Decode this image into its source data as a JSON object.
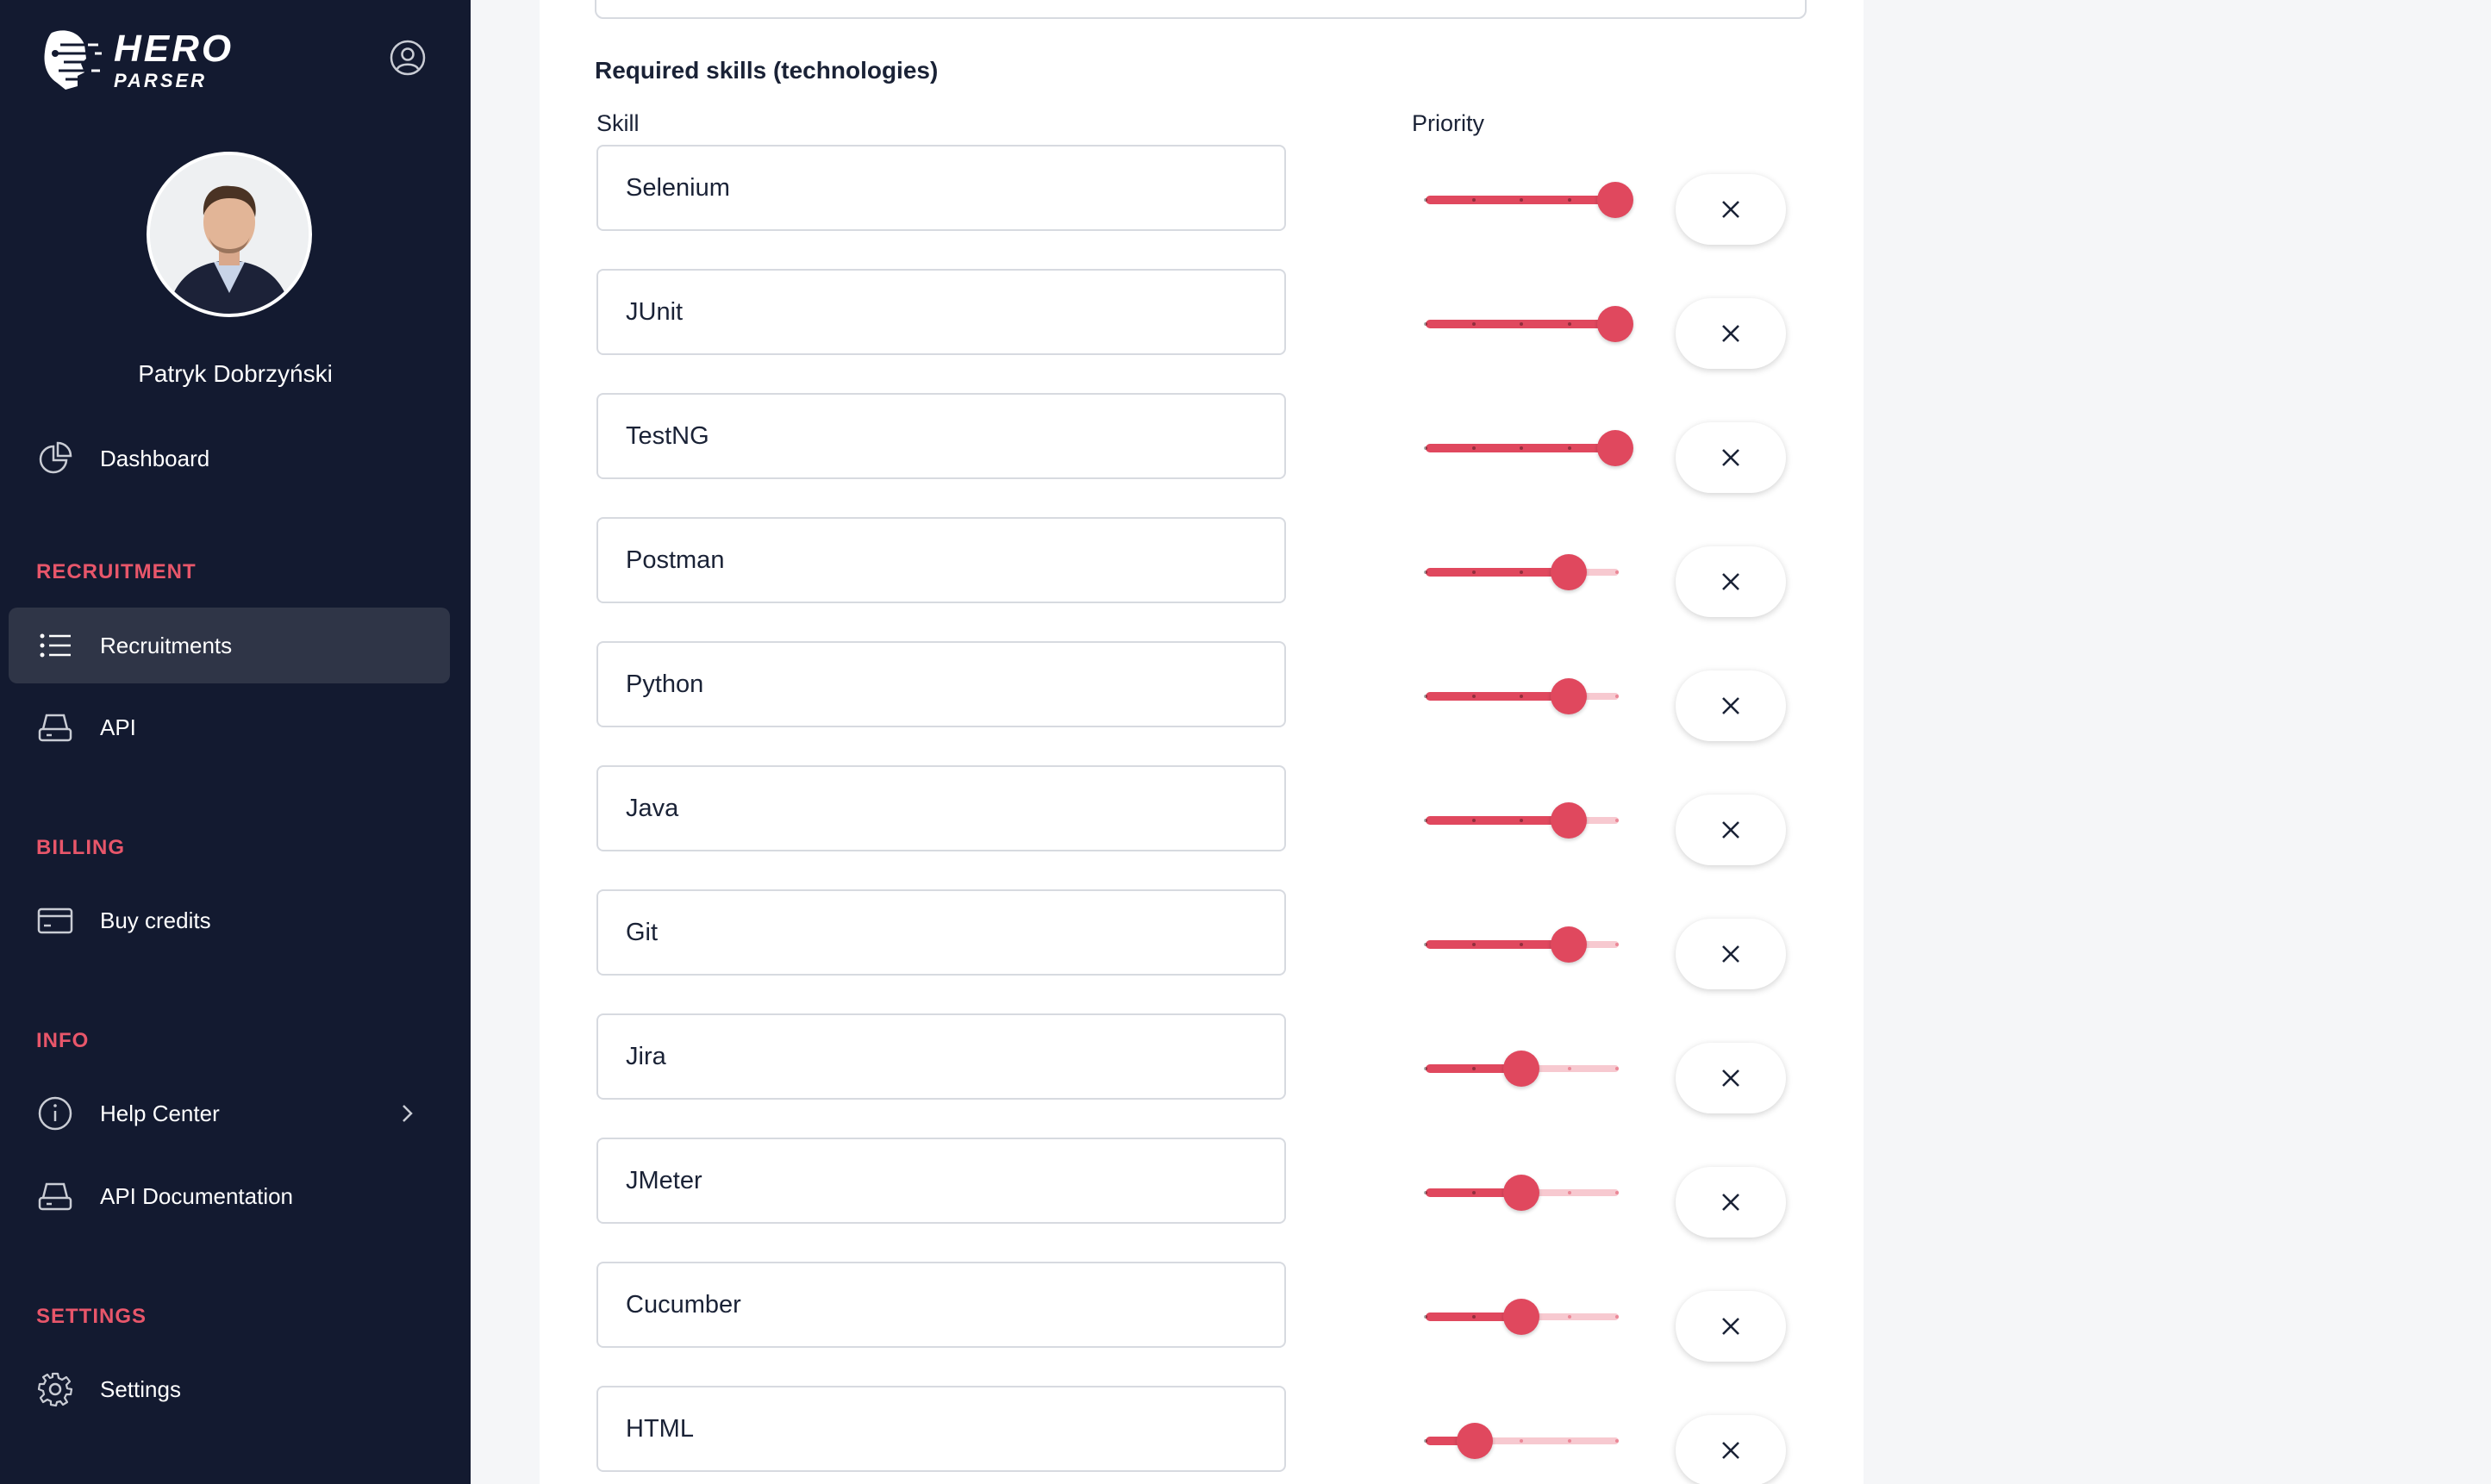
{
  "app": {
    "logo_line1": "HERO",
    "logo_line2": "PARSER"
  },
  "user": {
    "name": "Patryk Dobrzyński"
  },
  "sidebar": {
    "dashboard": "Dashboard",
    "sections": {
      "recruitment": "RECRUITMENT",
      "billing": "BILLING",
      "info": "INFO",
      "settings": "SETTINGS"
    },
    "items": {
      "recruitments": "Recruitments",
      "api": "API",
      "buy_credits": "Buy credits",
      "help_center": "Help Center",
      "api_documentation": "API Documentation",
      "settings": "Settings"
    }
  },
  "form": {
    "section_title": "Required skills (technologies)",
    "col_skill": "Skill",
    "col_priority": "Priority",
    "priority_max": 5,
    "skills": [
      {
        "name": "Selenium",
        "priority": 5
      },
      {
        "name": "JUnit",
        "priority": 5
      },
      {
        "name": "TestNG",
        "priority": 5
      },
      {
        "name": "Postman",
        "priority": 4
      },
      {
        "name": "Python",
        "priority": 4
      },
      {
        "name": "Java",
        "priority": 4
      },
      {
        "name": "Git",
        "priority": 4
      },
      {
        "name": "Jira",
        "priority": 3
      },
      {
        "name": "JMeter",
        "priority": 3
      },
      {
        "name": "Cucumber",
        "priority": 3
      },
      {
        "name": "HTML",
        "priority": 2
      }
    ]
  },
  "colors": {
    "sidebar_bg": "#131a30",
    "active_item_bg": "#2f3547",
    "accent": "#e0485e",
    "section_title": "#e8566a"
  },
  "icons": {
    "logo": "hero-logo-icon",
    "account": "user-circle-icon",
    "dashboard": "pie-chart-icon",
    "recruitments": "list-icon",
    "api": "drive-icon",
    "buy_credits": "credit-card-icon",
    "help_center": "info-icon",
    "api_documentation": "drive-icon",
    "settings": "gear-icon",
    "remove": "close-icon"
  }
}
